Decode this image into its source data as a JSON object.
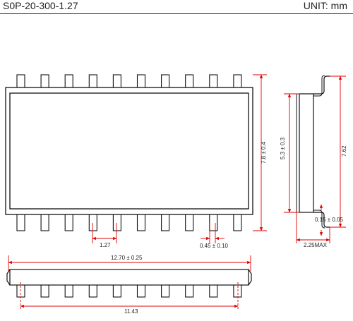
{
  "header": {
    "package_name": "S0P-20-300-1.27",
    "unit_label": "UNIT: mm"
  },
  "dimensions": {
    "pitch": "1.27",
    "lead_width": "0.45 ± 0.10",
    "body_length": "12.70 ± 0.25",
    "lead_span_bottom": "11.43",
    "overall_width": "7.8 ± 0.4",
    "body_width": "5.3 ± 0.3",
    "lead_length": "7.62",
    "lead_thickness": "0.15 ± 0.05",
    "max_height": "2.25MAX"
  },
  "colors": {
    "outline": "#111111",
    "dimension": "#e00000"
  },
  "top_view": {
    "pins_per_side": 10
  },
  "bottom_view": {
    "pins": 10
  }
}
